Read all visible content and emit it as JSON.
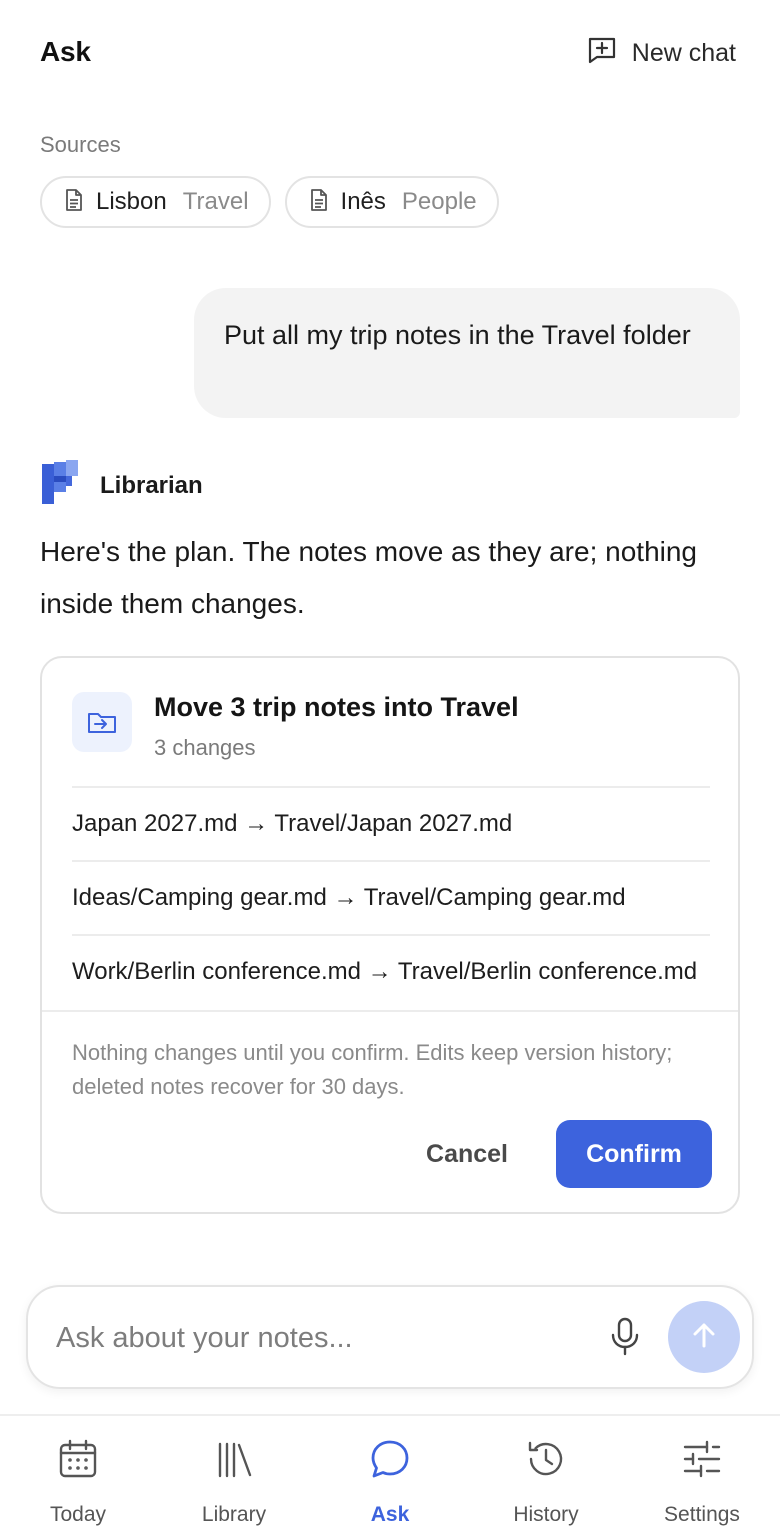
{
  "header": {
    "title": "Ask",
    "new_chat_label": "New chat"
  },
  "sources": {
    "label": "Sources",
    "chips": [
      {
        "name": "Lisbon",
        "folder": "Travel"
      },
      {
        "name": "Inês",
        "folder": "People"
      }
    ]
  },
  "user_message": "Put all my trip notes in the Travel folder",
  "assistant": {
    "name": "Librarian",
    "message": "Here's the plan. The notes move as they are; nothing inside them changes."
  },
  "plan_card": {
    "title": "Move 3 trip notes into Travel",
    "subtitle": "3 changes",
    "changes": [
      "Japan 2027.md → Travel/Japan 2027.md",
      "Ideas/Camping gear.md → Travel/Camping gear.md",
      "Work/Berlin conference.md → Travel/Berlin conference.md"
    ],
    "notice": "Nothing changes until you confirm. Edits keep version history; deleted notes recover for 30 days.",
    "cancel_label": "Cancel",
    "confirm_label": "Confirm"
  },
  "composer": {
    "placeholder": "Ask about your notes...",
    "value": ""
  },
  "nav": {
    "items": [
      {
        "label": "Today",
        "icon": "calendar-icon"
      },
      {
        "label": "Library",
        "icon": "library-icon"
      },
      {
        "label": "Ask",
        "icon": "chat-bubble-icon"
      },
      {
        "label": "History",
        "icon": "history-icon"
      },
      {
        "label": "Settings",
        "icon": "sliders-icon"
      }
    ],
    "active": "Ask"
  },
  "colors": {
    "accent": "#3d63dd",
    "send_disabled": "#c3d1f7",
    "icon_tint_bg": "#edf2fd"
  }
}
